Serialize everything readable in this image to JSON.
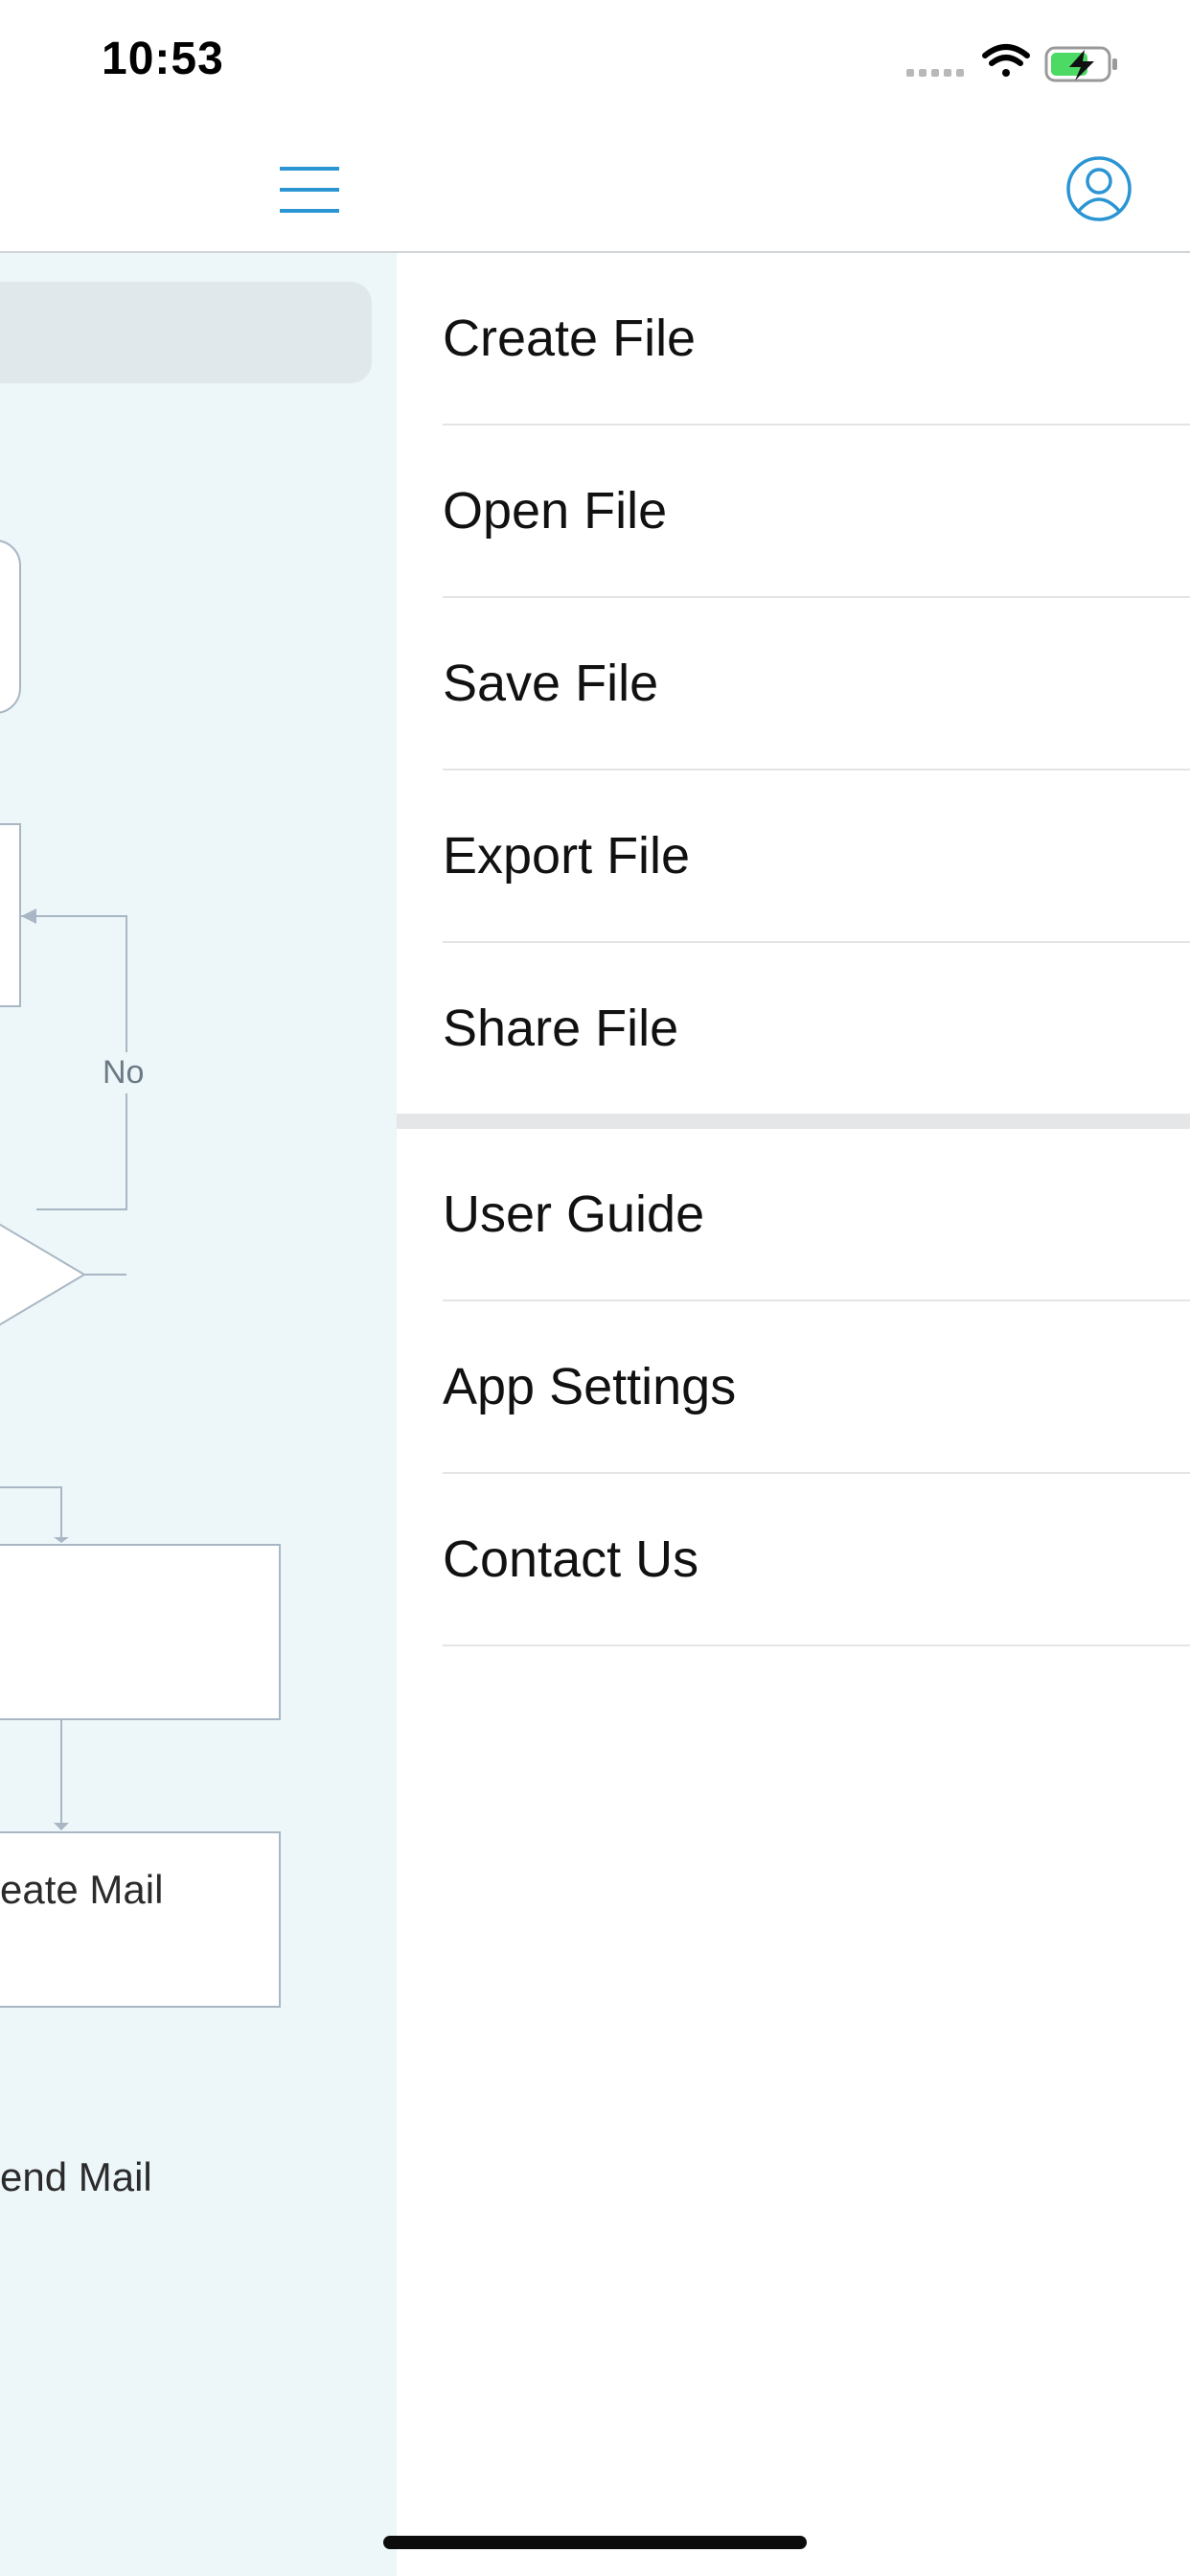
{
  "status_bar": {
    "time": "10:53",
    "icons": [
      "signal-dots-icon",
      "wifi-icon",
      "battery-charging-icon"
    ]
  },
  "nav_bar": {
    "menu_icon": "hamburger-menu-icon",
    "profile_icon": "user-profile-icon",
    "accent_color": "#2b95d3"
  },
  "canvas": {
    "decision_label": "No",
    "nodes": [
      "eate Mail",
      "end Mail"
    ]
  },
  "drawer": {
    "file_items": [
      {
        "label": "Create File"
      },
      {
        "label": "Open File"
      },
      {
        "label": "Save File"
      },
      {
        "label": "Export File"
      },
      {
        "label": "Share File"
      }
    ],
    "help_items": [
      {
        "label": "User Guide"
      },
      {
        "label": "App Settings"
      },
      {
        "label": "Contact Us"
      }
    ]
  }
}
